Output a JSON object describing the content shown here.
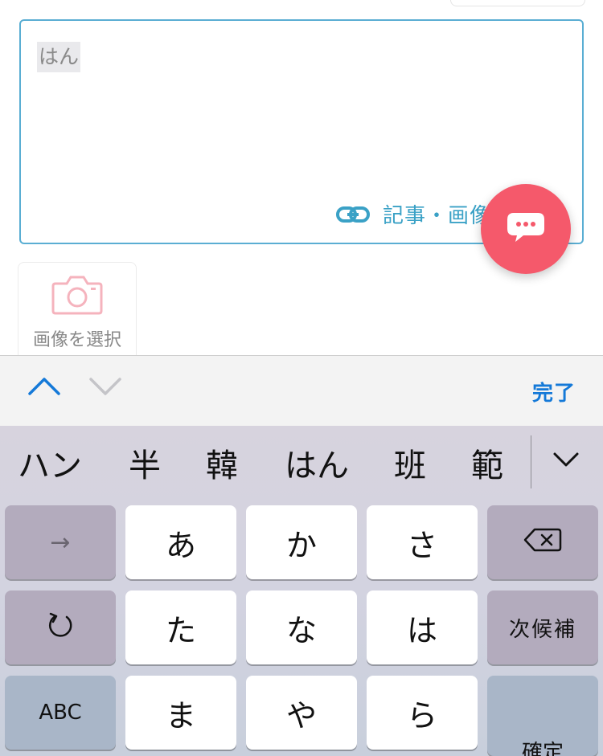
{
  "compose": {
    "text": "はん",
    "link_label": "記事・画像"
  },
  "image_picker": {
    "label": "画像を選択"
  },
  "toolbar": {
    "done_label": "完了"
  },
  "candidates": [
    "ハン",
    "半",
    "韓",
    "はん",
    "班",
    "範"
  ],
  "keys": {
    "row1": [
      "→",
      "あ",
      "か",
      "さ"
    ],
    "row2": [
      "た",
      "な",
      "は",
      "次候補"
    ],
    "row3": [
      "ABC",
      "ま",
      "や",
      "ら",
      "確定"
    ]
  },
  "colors": {
    "accent_blue": "#1479d8",
    "compose_border": "#5aaed3",
    "link_teal": "#3aa1c6",
    "fab": "#f5596b",
    "camera_pink": "#f5b3bd"
  },
  "icons": [
    "link-icon",
    "chat-bubble-icon",
    "camera-icon",
    "chevron-up-icon",
    "chevron-down-icon",
    "undo-icon",
    "delete-icon"
  ]
}
